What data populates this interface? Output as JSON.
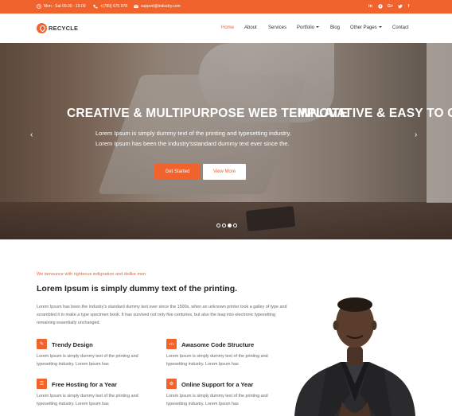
{
  "topbar": {
    "hours": "Mon - Sat 09.00 - 19.00",
    "phone": "+(789) 675 978",
    "email": "support@industry.com",
    "social_icons": [
      "linkedin-icon",
      "pinterest-icon",
      "google-plus-icon",
      "twitter-icon",
      "facebook-icon"
    ],
    "social_labels": [
      "in",
      "p",
      "G+",
      "t",
      "f"
    ]
  },
  "brand": {
    "name": "RECYCLE",
    "accent": "#f0632c"
  },
  "nav": {
    "items": [
      {
        "label": "Home",
        "active": true
      },
      {
        "label": "About"
      },
      {
        "label": "Services"
      },
      {
        "label": "Portfolio"
      },
      {
        "label": "Blog"
      },
      {
        "label": "Other Pages"
      },
      {
        "label": "Contact"
      }
    ]
  },
  "hero": {
    "title": "CREATIVE & MULTIPURPOSE WEB TEMPLATE",
    "title_next": "INNOVATIVE & EASY TO C",
    "subtitle_line1": "Lorem Ipsum is simply dummy text of the printing and typesetting industry.",
    "subtitle_line2": "Lorem Ipsum has been the industry'sstandard dummy text ever since the.",
    "primary_button": "Get Started",
    "secondary_button": "View More",
    "dots_total": 4,
    "dots_active_index": 2
  },
  "about": {
    "kicker": "We denounce with righteous indignation and dislike men",
    "title": "Lorem Ipsum is simply dummy text of the printing.",
    "text": "Lorem Ipsum has been the industry's standard dummy text ever since the 1500s, when an unknown printer took a galley of type and scrambled it to make a type specimen book. It has survived not only five centuries, but also the leap into electronic typesetting remaining essentially unchanged.",
    "features": [
      {
        "title": "Trendy Design",
        "icon": "pencil-icon",
        "glyph": "✎",
        "text": "Lorem Ipsum is simply dummy text of the printing and typesetting industry. Lorem Ipsum has"
      },
      {
        "title": "Awasome Code Structure",
        "icon": "code-icon",
        "glyph": "</>",
        "text": "Lorem Ipsum is simply dummy text of the printing and typesetting industry. Lorem Ipsum has"
      },
      {
        "title": "Free Hosting for a Year",
        "icon": "server-icon",
        "glyph": "☰",
        "text": "Lorem Ipsum is simply dummy text of the printing and typesetting industry. Lorem Ipsum has"
      },
      {
        "title": "Online Support for a Year",
        "icon": "support-icon",
        "glyph": "⚙",
        "text": "Lorem Ipsum is simply dummy text of the printing and typesetting industry. Lorem Ipsum has"
      }
    ]
  }
}
